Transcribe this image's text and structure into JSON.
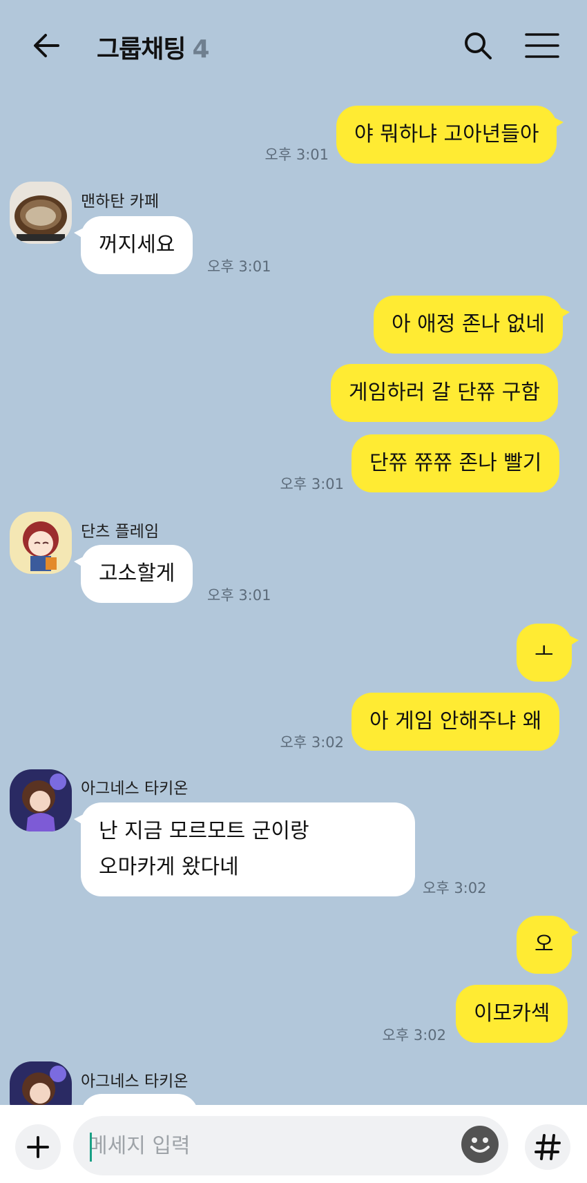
{
  "header": {
    "title": "그룹채팅",
    "member_count": "4"
  },
  "messages": {
    "m1": {
      "text": "야 뭐하냐 고아년들아",
      "time": "오후 3:01"
    },
    "m2": {
      "sender": "맨하탄 카페",
      "text": "꺼지세요",
      "time": "오후 3:01"
    },
    "m3": {
      "text": "아 애정 존나 없네"
    },
    "m4": {
      "text": "게임하러 갈 단쮸 구함"
    },
    "m5": {
      "text": "단쮸 쮸쮸 존나 빨기",
      "time": "오후 3:01"
    },
    "m6": {
      "sender": "단츠 플레임",
      "text": "고소할게",
      "time": "오후 3:01"
    },
    "m7": {
      "text": "ㅗ"
    },
    "m8": {
      "text": "아 게임 안해주냐 왜",
      "time": "오후 3:02"
    },
    "m9": {
      "sender": "아그네스 타키온",
      "line1": "난 지금 모르모트 군이랑",
      "line2": "오마카게 왔다네",
      "time": "오후 3:02"
    },
    "m10": {
      "text": "오"
    },
    "m11": {
      "text": "이모카섹",
      "time": "오후 3:02"
    },
    "m12": {
      "sender": "아그네스 타키온"
    }
  },
  "input": {
    "placeholder": "메세지 입력"
  },
  "icons": {
    "back": "arrow-left-icon",
    "search": "search-icon",
    "menu": "hamburger-menu-icon",
    "plus": "plus-icon",
    "emoji": "emoji-icon",
    "hash": "hash-icon"
  },
  "colors": {
    "background": "#b2c7da",
    "my_bubble": "#ffeb33",
    "other_bubble": "#ffffff"
  }
}
